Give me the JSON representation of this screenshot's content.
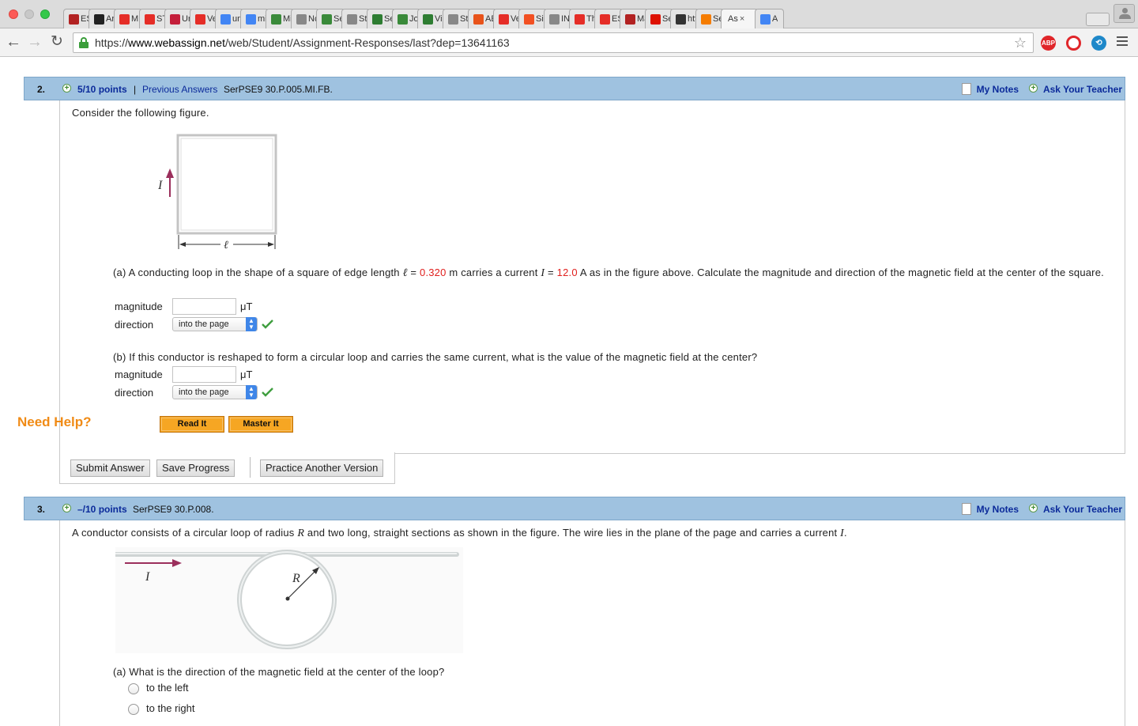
{
  "browser": {
    "tabs": [
      {
        "label": "ES",
        "icon": "ess-logo-icon",
        "color": "#b22222"
      },
      {
        "label": "Ar",
        "icon": "amazon-icon",
        "color": "#222222"
      },
      {
        "label": "M",
        "icon": "youtube-icon",
        "color": "#e52d27"
      },
      {
        "label": "ST",
        "icon": "youtube-icon",
        "color": "#e52d27"
      },
      {
        "label": "Ur",
        "icon": "uc-logo-icon",
        "color": "#c41e3a"
      },
      {
        "label": "Ve",
        "icon": "red-square-icon",
        "color": "#e52d27"
      },
      {
        "label": "un",
        "icon": "google-icon",
        "color": "#4285f4"
      },
      {
        "label": "mi",
        "icon": "google-icon",
        "color": "#4285f4"
      },
      {
        "label": "Mi",
        "icon": "sq-icon",
        "color": "#3a8a3a"
      },
      {
        "label": "Nc",
        "icon": "document-icon",
        "color": "#888888"
      },
      {
        "label": "Se",
        "icon": "sq-icon",
        "color": "#3a8a3a"
      },
      {
        "label": "St",
        "icon": "document-icon",
        "color": "#888888"
      },
      {
        "label": "Se",
        "icon": "n-icon",
        "color": "#2e7d32"
      },
      {
        "label": "Jo",
        "icon": "sq-icon",
        "color": "#3a8a3a"
      },
      {
        "label": "Vis",
        "icon": "n-icon",
        "color": "#2e7d32"
      },
      {
        "label": "St",
        "icon": "document-icon",
        "color": "#888888"
      },
      {
        "label": "AE",
        "icon": "a-icon",
        "color": "#e8531a"
      },
      {
        "label": "Ve",
        "icon": "red-square-icon",
        "color": "#e52d27"
      },
      {
        "label": "Sig",
        "icon": "microsoft-icon",
        "color": "#f25022"
      },
      {
        "label": "IN",
        "icon": "document-icon",
        "color": "#888888"
      },
      {
        "label": "Th",
        "icon": "youtube-icon",
        "color": "#e52d27"
      },
      {
        "label": "ES",
        "icon": "youtube-icon",
        "color": "#e52d27"
      },
      {
        "label": "Ma",
        "icon": "ess-logo-icon",
        "color": "#b22222"
      },
      {
        "label": "Se",
        "icon": "wolfram-icon",
        "color": "#dd1100"
      },
      {
        "label": "htt",
        "icon": "bb-icon",
        "color": "#333333"
      },
      {
        "label": "Se",
        "icon": "c-icon",
        "color": "#f57c00"
      },
      {
        "label": "As",
        "icon": "",
        "color": "#ffffff",
        "active": true
      },
      {
        "label": "A",
        "icon": "google-icon",
        "color": "#4285f4"
      }
    ],
    "url_scheme": "https://",
    "url_host": "www.webassign.net",
    "url_path": "/web/Student/Assignment-Responses/last?dep=13641163",
    "ext_abp": "ABP"
  },
  "q2": {
    "number": "2.",
    "points": "5/10 points",
    "sep": "|",
    "previous_answers": "Previous Answers",
    "code": "SerPSE9 30.P.005.MI.FB.",
    "my_notes": "My Notes",
    "ask_teacher": "Ask Your Teacher",
    "stem": "Consider the following figure.",
    "figure": {
      "current_label": "I",
      "length_label": "ℓ"
    },
    "part_a": {
      "t1": "(a) A conducting loop in the shape of a square of edge length ",
      "l_sym": "ℓ",
      "eq": " = ",
      "l_val": "0.320",
      "t2": " m carries a current ",
      "i_sym": "I",
      "i_val": "12.0",
      "t3": " A as in the figure above. Calculate the magnitude and direction of the magnetic field at the center of the square.",
      "magnitude_label": "magnitude",
      "magnitude_value": "",
      "unit": "μT",
      "direction_label": "direction",
      "direction_value": "into the page"
    },
    "part_b": {
      "text": "(b) If this conductor is reshaped to form a circular loop and carries the same current, what is the value of the magnetic field at the center?",
      "magnitude_label": "magnitude",
      "magnitude_value": "",
      "unit": "μT",
      "direction_label": "direction",
      "direction_value": "into the page"
    },
    "need_help": "Need Help?",
    "read_it": "Read It",
    "master_it": "Master It",
    "submit": "Submit Answer",
    "save": "Save Progress",
    "practice": "Practice Another Version"
  },
  "q3": {
    "number": "3.",
    "points": "–/10 points",
    "code": "SerPSE9 30.P.008.",
    "my_notes": "My Notes",
    "ask_teacher": "Ask Your Teacher",
    "stem_a": "A conductor consists of a circular loop of radius ",
    "stem_r": "R",
    "stem_b": " and two long, straight sections as shown in the figure. The wire lies in the plane of the page and carries a current ",
    "stem_i": "I",
    "stem_c": ".",
    "figure": {
      "current_label": "I",
      "radius_label": "R"
    },
    "part_a": "(a) What is the direction of the magnetic field at the center of the loop?",
    "options": [
      "to the left",
      "to the right"
    ]
  },
  "colors": {
    "accent_link": "#0b2a9a",
    "header_bar": "#9fc2e0",
    "help_orange": "#f08b16",
    "given_value_red": "#e0201e",
    "check_green": "#3f9e3f"
  }
}
